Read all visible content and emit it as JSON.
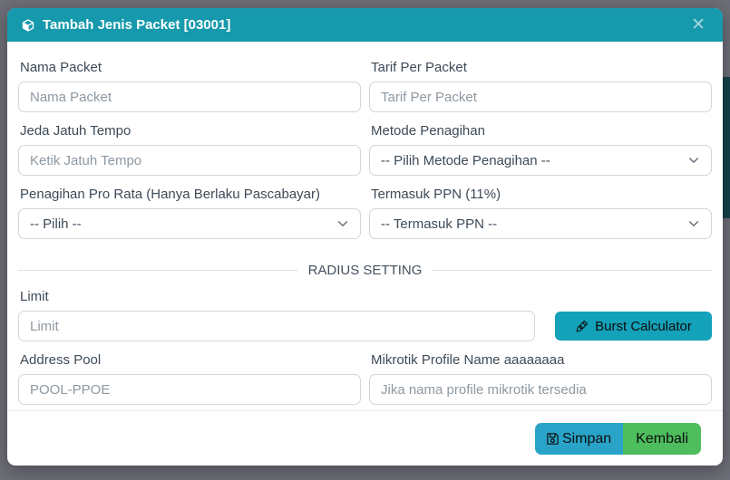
{
  "modal": {
    "title": "Tambah Jenis Packet [03001]",
    "close_glyph": "✕"
  },
  "form": {
    "nama_packet": {
      "label": "Nama Packet",
      "placeholder": "Nama Packet"
    },
    "tarif_per_packet": {
      "label": "Tarif Per Packet",
      "placeholder": "Tarif Per Packet"
    },
    "jeda_jatuh_tempo": {
      "label": "Jeda Jatuh Tempo",
      "placeholder": "Ketik Jatuh Tempo"
    },
    "metode_penagihan": {
      "label": "Metode Penagihan",
      "selected": "-- Pilih Metode Penagihan --"
    },
    "penagihan_pro_rata": {
      "label": "Penagihan Pro Rata (Hanya Berlaku Pascabayar)",
      "selected": "-- Pilih --"
    },
    "termasuk_ppn": {
      "label": "Termasuk PPN (11%)",
      "selected": "-- Termasuk PPN --"
    },
    "limit": {
      "label": "Limit",
      "placeholder": "Limit"
    },
    "address_pool": {
      "label": "Address Pool",
      "placeholder": "POOL-PPOE"
    },
    "mikrotik_profile": {
      "label": "Mikrotik Profile Name aaaaaaaa",
      "placeholder": "Jika nama profile mikrotik tersedia"
    }
  },
  "sections": {
    "radius_setting": "RADIUS SETTING"
  },
  "buttons": {
    "burst_calculator": "Burst Calculator",
    "simpan": "Simpan",
    "kembali": "Kembali"
  },
  "icons": {
    "header": "cube-icon",
    "burst": "pen-nib-icon",
    "simpan": "floppy-save-icon",
    "selects": "chevron-down-icon"
  },
  "colors": {
    "header_teal": "#1699ac",
    "burst_button_teal": "#14a2ba",
    "simpan_button_blue": "#29a4c8",
    "kembali_button_green": "#4dbd5e",
    "backdrop_gray": "#6e6e78",
    "backdrop_strip_dark_teal": "#16424b",
    "label_text": "#3d4a57",
    "placeholder_text": "#8d98a2",
    "input_border": "#ced7de"
  }
}
